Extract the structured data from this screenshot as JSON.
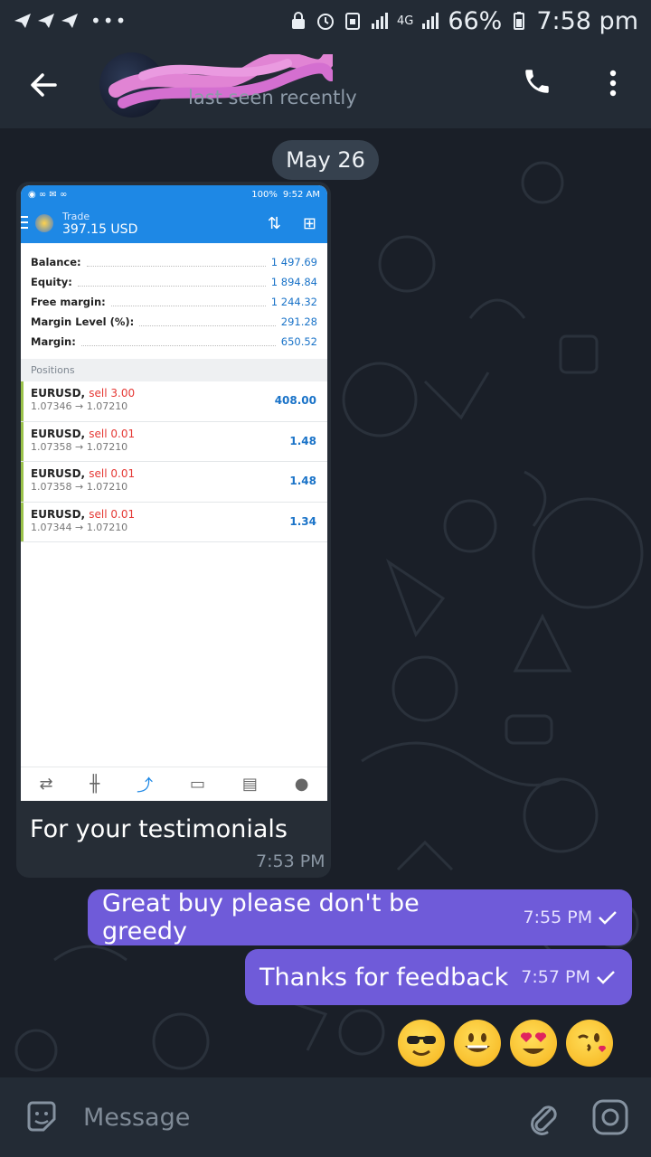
{
  "status_bar": {
    "battery": "66%",
    "time": "7:58 pm",
    "network": "4G"
  },
  "header": {
    "subtitle": "last seen recently"
  },
  "chat": {
    "date": "May 26",
    "incoming": {
      "caption": "For your testimonials",
      "time": "7:53 PM",
      "screenshot": {
        "status_time": "9:52 AM",
        "status_battery": "100%",
        "title": "Trade",
        "balance_header": "397.15 USD",
        "summary": [
          {
            "label": "Balance:",
            "value": "1 497.69"
          },
          {
            "label": "Equity:",
            "value": "1 894.84"
          },
          {
            "label": "Free margin:",
            "value": "1 244.32"
          },
          {
            "label": "Margin Level (%):",
            "value": "291.28"
          },
          {
            "label": "Margin:",
            "value": "650.52"
          }
        ],
        "positions_label": "Positions",
        "positions": [
          {
            "symbol": "EURUSD,",
            "dir": "sell 3.00",
            "prices": "1.07346 → 1.07210",
            "pnl": "408.00"
          },
          {
            "symbol": "EURUSD,",
            "dir": "sell 0.01",
            "prices": "1.07358 → 1.07210",
            "pnl": "1.48"
          },
          {
            "symbol": "EURUSD,",
            "dir": "sell 0.01",
            "prices": "1.07358 → 1.07210",
            "pnl": "1.48"
          },
          {
            "symbol": "EURUSD,",
            "dir": "sell 0.01",
            "prices": "1.07344 → 1.07210",
            "pnl": "1.34"
          }
        ]
      }
    },
    "outgoing": [
      {
        "text": "Great buy please don't be greedy",
        "time": "7:55 PM"
      },
      {
        "text": "Thanks for feedback",
        "time": "7:57 PM"
      }
    ],
    "emojis": [
      "sunglasses-emoji",
      "grinning-emoji",
      "heart-eyes-emoji",
      "kissing-wink-emoji"
    ]
  },
  "input": {
    "placeholder": "Message"
  },
  "colors": {
    "bubble_out": "#6f5bd9",
    "bubble_in": "#262d36",
    "header": "#232b35",
    "mt_blue": "#1e88e5"
  }
}
